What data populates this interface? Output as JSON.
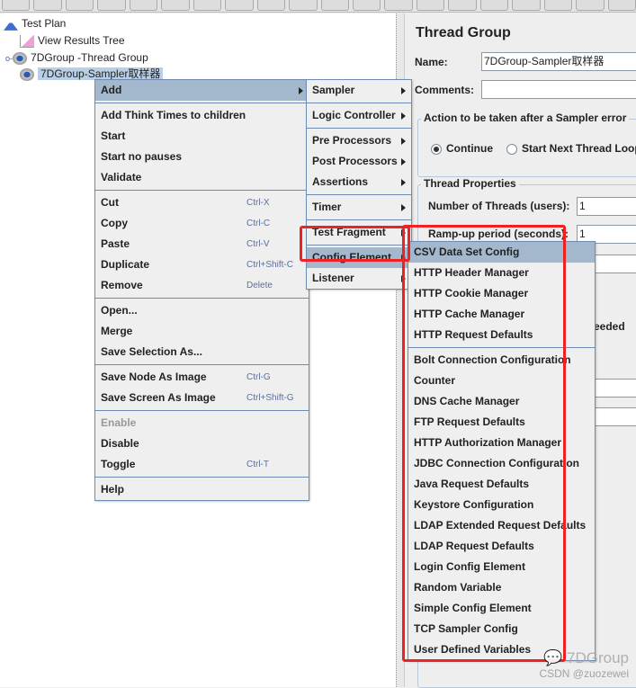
{
  "tree": {
    "items": [
      {
        "label": "Test Plan",
        "icon": "test-plan-flask-icon"
      },
      {
        "label": "View Results Tree",
        "icon": "results-tree-chart-icon"
      },
      {
        "label": "7DGroup -Thread Group",
        "icon": "gear-icon"
      },
      {
        "label": "7DGroup-Sampler取样器",
        "icon": "gear-icon",
        "selected": true
      }
    ]
  },
  "panel": {
    "title": "Thread Group",
    "name_label": "Name:",
    "name_value": "7DGroup-Sampler取样器",
    "comments_label": "Comments:",
    "comments_value": "",
    "action_legend": "Action to be taken after a Sampler error",
    "radio_continue": "Continue",
    "radio_next": "Start Next Thread Loop",
    "props_legend": "Thread Properties",
    "threads_label": "Number of Threads (users):",
    "threads_value": "1",
    "rampup_label": "Ramp-up period (seconds):",
    "rampup_value": "1",
    "partial_text": "eeded"
  },
  "context_menu": [
    {
      "label": "Add",
      "submenu": true,
      "highlight": true
    },
    {
      "sep": true
    },
    {
      "label": "Add Think Times to children"
    },
    {
      "label": "Start"
    },
    {
      "label": "Start no pauses"
    },
    {
      "label": "Validate"
    },
    {
      "sep": true
    },
    {
      "label": "Cut",
      "shortcut": "Ctrl-X"
    },
    {
      "label": "Copy",
      "shortcut": "Ctrl-C"
    },
    {
      "label": "Paste",
      "shortcut": "Ctrl-V"
    },
    {
      "label": "Duplicate",
      "shortcut": "Ctrl+Shift-C"
    },
    {
      "label": "Remove",
      "shortcut": "Delete"
    },
    {
      "sep": true
    },
    {
      "label": "Open..."
    },
    {
      "label": "Merge"
    },
    {
      "label": "Save Selection As..."
    },
    {
      "sep": true
    },
    {
      "label": "Save Node As Image",
      "shortcut": "Ctrl-G"
    },
    {
      "label": "Save Screen As Image",
      "shortcut": "Ctrl+Shift-G"
    },
    {
      "sep": true
    },
    {
      "label": "Enable",
      "disabled": true
    },
    {
      "label": "Disable"
    },
    {
      "label": "Toggle",
      "shortcut": "Ctrl-T"
    },
    {
      "sep": true
    },
    {
      "label": "Help"
    }
  ],
  "add_submenu": [
    {
      "label": "Sampler",
      "submenu": true
    },
    {
      "sep": true
    },
    {
      "label": "Logic Controller",
      "submenu": true
    },
    {
      "sep": true
    },
    {
      "label": "Pre Processors",
      "submenu": true
    },
    {
      "label": "Post Processors",
      "submenu": true
    },
    {
      "label": "Assertions",
      "submenu": true
    },
    {
      "sep": true
    },
    {
      "label": "Timer",
      "submenu": true
    },
    {
      "sep": true
    },
    {
      "label": "Test Fragment",
      "submenu": true
    },
    {
      "sep": true
    },
    {
      "label": "Config Element",
      "submenu": true,
      "highlight": true
    },
    {
      "label": "Listener",
      "submenu": true
    }
  ],
  "config_submenu": [
    {
      "label": "CSV Data Set Config",
      "highlight": true
    },
    {
      "label": "HTTP Header Manager"
    },
    {
      "label": "HTTP Cookie Manager"
    },
    {
      "label": "HTTP Cache Manager"
    },
    {
      "label": "HTTP Request Defaults"
    },
    {
      "sep": true
    },
    {
      "label": "Bolt Connection Configuration"
    },
    {
      "label": "Counter"
    },
    {
      "label": "DNS Cache Manager"
    },
    {
      "label": "FTP Request Defaults"
    },
    {
      "label": "HTTP Authorization Manager"
    },
    {
      "label": "JDBC Connection Configuration"
    },
    {
      "label": "Java Request Defaults"
    },
    {
      "label": "Keystore Configuration"
    },
    {
      "label": "LDAP Extended Request Defaults"
    },
    {
      "label": "LDAP Request Defaults"
    },
    {
      "label": "Login Config Element"
    },
    {
      "label": "Random Variable"
    },
    {
      "label": "Simple Config Element"
    },
    {
      "label": "TCP Sampler Config"
    },
    {
      "label": "User Defined Variables"
    }
  ],
  "watermark": {
    "brand": "7DGroup",
    "credit": "CSDN @zuozewei"
  },
  "colors": {
    "highlight": "#a3b8cc",
    "menu_border": "#6f8bb3",
    "annotation": "#ee2222",
    "selection": "#b8cfe5"
  }
}
